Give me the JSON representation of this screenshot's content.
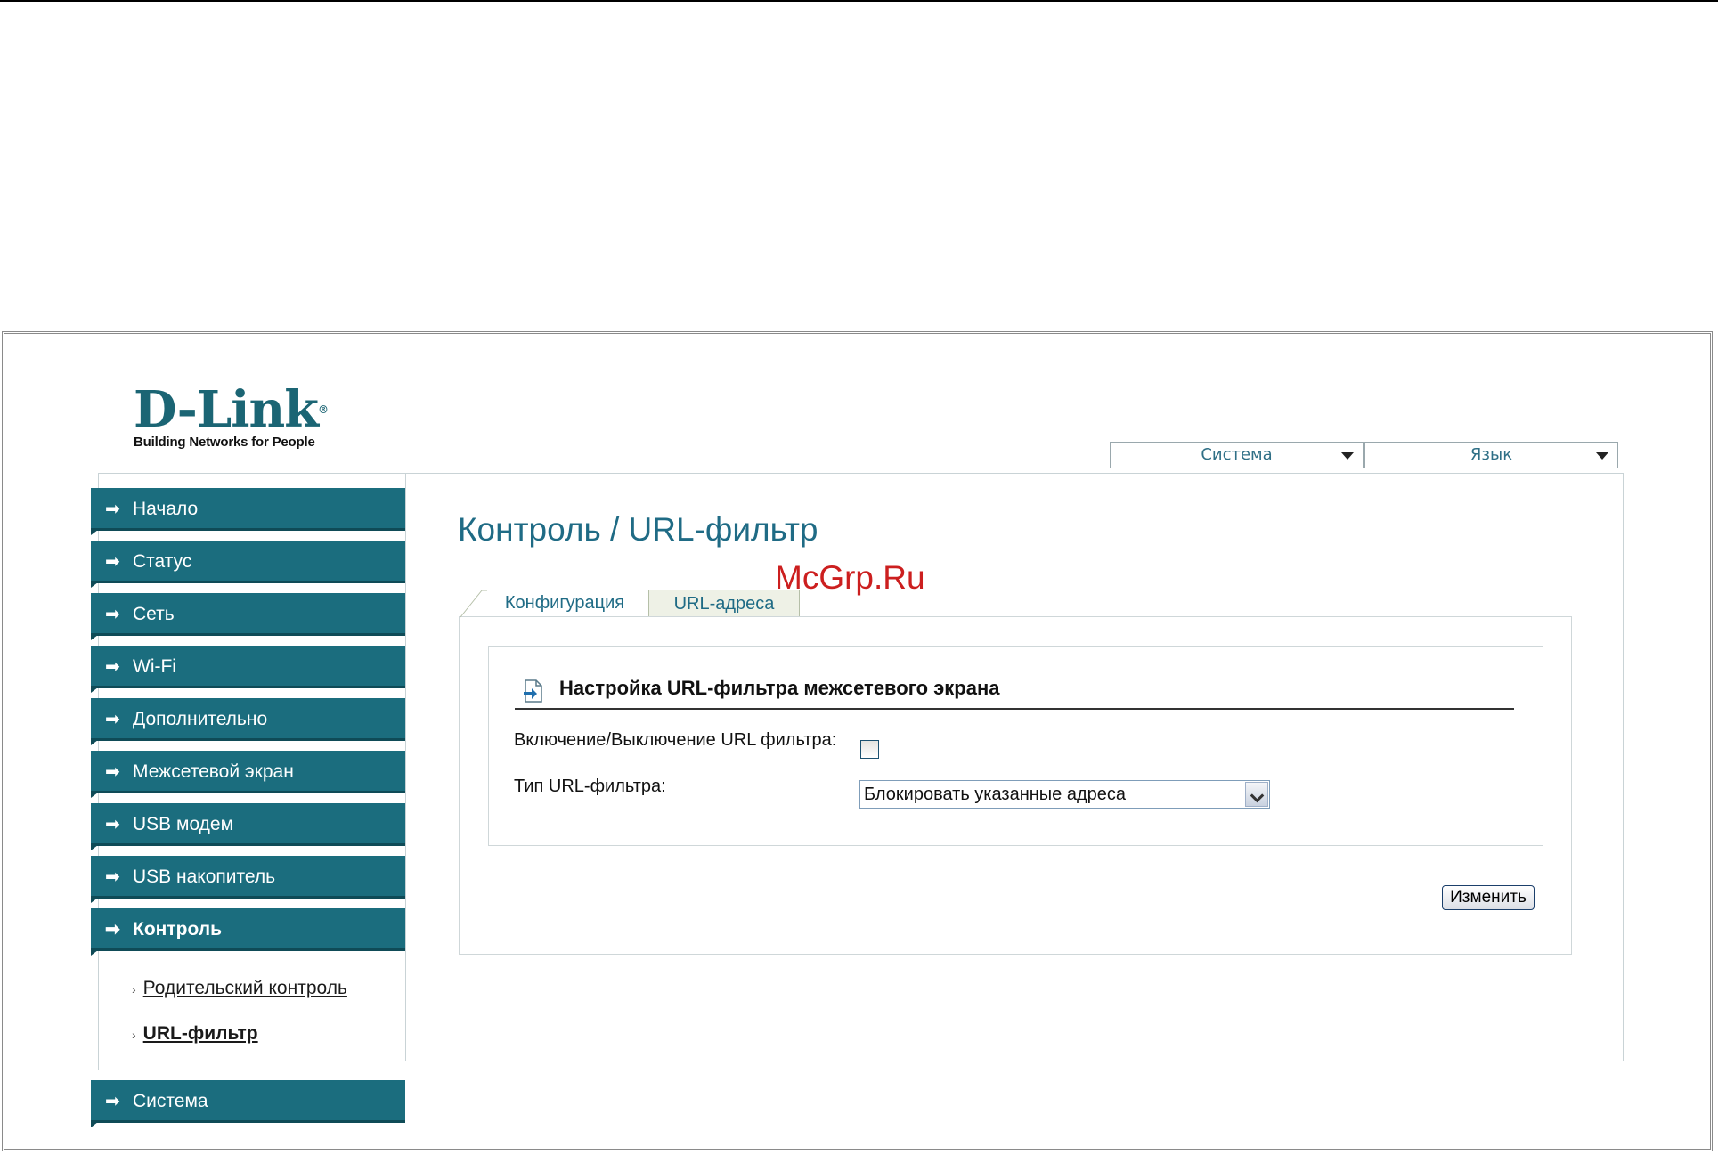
{
  "logo": {
    "brand": "D-Link",
    "tagline": "Building Networks for People"
  },
  "top_menu": {
    "system": "Система",
    "language": "Язык"
  },
  "sidebar": {
    "items": [
      {
        "label": "Начало"
      },
      {
        "label": "Статус"
      },
      {
        "label": "Сеть"
      },
      {
        "label": "Wi-Fi"
      },
      {
        "label": "Дополнительно"
      },
      {
        "label": "Межсетевой экран"
      },
      {
        "label": "USB модем"
      },
      {
        "label": "USB накопитель"
      },
      {
        "label": "Контроль"
      },
      {
        "label": "Система"
      }
    ],
    "sub_items": [
      {
        "label": "Родительский контроль"
      },
      {
        "label": "URL-фильтр"
      }
    ]
  },
  "main": {
    "title": "Контроль / URL-фильтр",
    "tabs": [
      {
        "label": "Конфигурация"
      },
      {
        "label": "URL-адреса"
      }
    ],
    "section_title": "Настройка URL-фильтра межсетевого экрана",
    "fields": {
      "enable_label": "Включение/Выключение URL фильтра:",
      "enable_checked": false,
      "type_label": "Тип URL-фильтра:",
      "type_value": "Блокировать указанные адреса"
    },
    "apply_label": "Изменить"
  },
  "watermark": "McGrp.Ru",
  "colors": {
    "accent": "#1b6d7e",
    "title": "#1f6b85",
    "watermark": "#cc1f1f"
  }
}
